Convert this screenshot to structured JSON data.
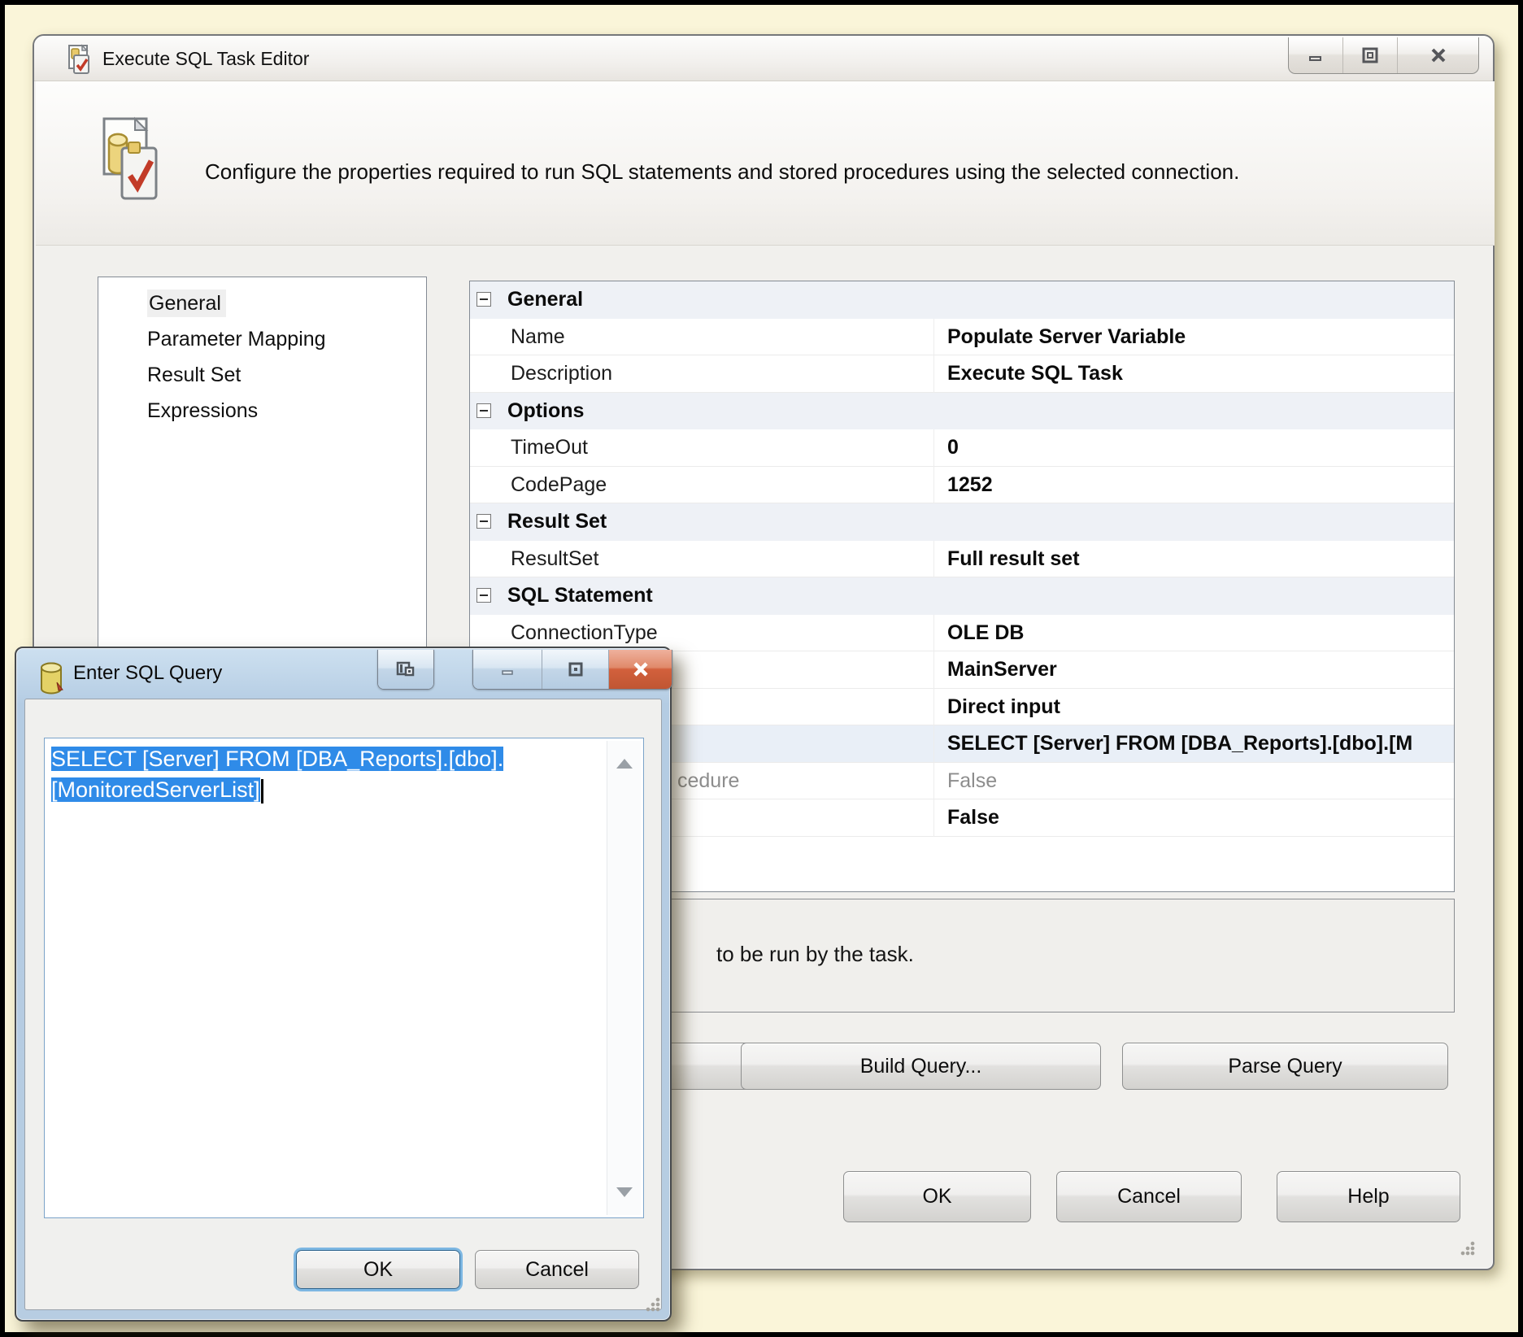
{
  "colors": {
    "page_background": "#faf5d9",
    "selection_blue": "#2f8be8",
    "close_button_red": "#c05633",
    "group_row_tint": "#eef1f6",
    "selected_row_tint": "#e9eff7"
  },
  "main_window": {
    "title": "Execute SQL Task Editor",
    "banner_text": "Configure the properties required to run SQL statements and stored procedures using the selected connection.",
    "nav": {
      "selected": "General",
      "items": [
        "General",
        "Parameter Mapping",
        "Result Set",
        "Expressions"
      ]
    },
    "property_grid": {
      "rows": [
        {
          "type": "group",
          "label": "General"
        },
        {
          "type": "prop",
          "label": "Name",
          "value": "Populate Server Variable"
        },
        {
          "type": "prop",
          "label": "Description",
          "value": "Execute SQL Task"
        },
        {
          "type": "group",
          "label": "Options"
        },
        {
          "type": "prop",
          "label": "TimeOut",
          "value": "0"
        },
        {
          "type": "prop",
          "label": "CodePage",
          "value": "1252"
        },
        {
          "type": "group",
          "label": "Result Set"
        },
        {
          "type": "prop",
          "label": "ResultSet",
          "value": "Full result set"
        },
        {
          "type": "group",
          "label": "SQL Statement"
        },
        {
          "type": "prop",
          "label": "ConnectionType",
          "value": "OLE DB"
        },
        {
          "type": "prop",
          "label": "",
          "value": "MainServer"
        },
        {
          "type": "prop",
          "label": "",
          "value": "Direct input"
        },
        {
          "type": "prop",
          "label": "",
          "value": "SELECT [Server] FROM [DBA_Reports].[dbo].[M"
        },
        {
          "type": "prop",
          "label": "cedure",
          "value": "False"
        },
        {
          "type": "prop",
          "label": "",
          "value": "False"
        }
      ]
    },
    "description_panel_text": "to be run by the task.",
    "buttons": {
      "build_query": "Build Query...",
      "parse_query": "Parse Query",
      "ok": "OK",
      "cancel": "Cancel",
      "help": "Help"
    }
  },
  "sql_dialog": {
    "title": "Enter SQL Query",
    "query_selected_line1": "SELECT [Server] FROM [DBA_Reports].[dbo].",
    "query_selected_line2": "[MonitoredServerList]",
    "buttons": {
      "ok": "OK",
      "cancel": "Cancel"
    }
  }
}
